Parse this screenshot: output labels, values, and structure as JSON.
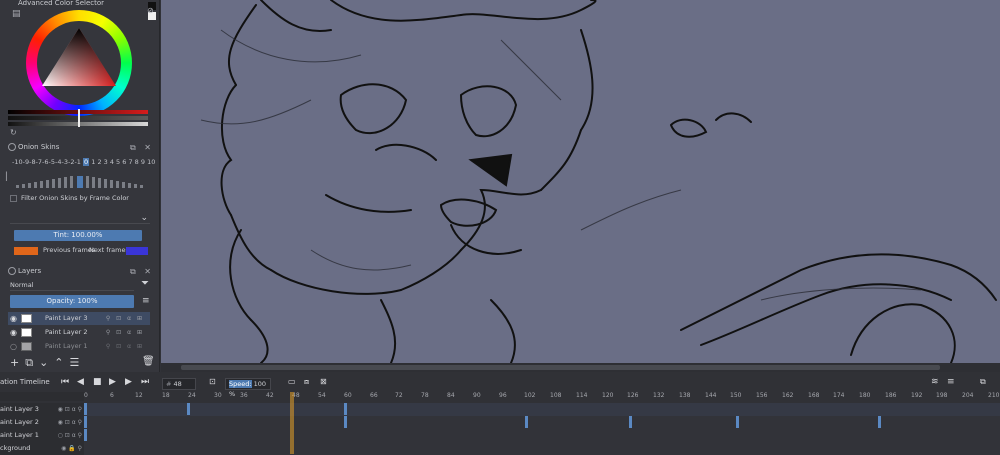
{
  "color_selector": {
    "title": "Advanced Color Selector"
  },
  "onion_skins": {
    "title": "Onion Skins",
    "frame_numbers": "-10-9-8-7-6-5-4-3-2-1",
    "current": "0",
    "frame_numbers_after": "1 2 3 4 5 6 7 8 9 10",
    "filter_label": "Filter Onion Skins by Frame Color",
    "tint": "Tint: 100.00%",
    "previous_label": "Previous frames",
    "next_label": "Next frames",
    "previous_color": "#e0661a",
    "next_color": "#3a35d8"
  },
  "layers": {
    "title": "Layers",
    "blend_mode": "Normal",
    "opacity": "Opacity:  100%",
    "items": [
      {
        "name": "Paint Layer 3"
      },
      {
        "name": "Paint Layer 2"
      },
      {
        "name": "Paint Layer 1"
      }
    ]
  },
  "timeline": {
    "title": "ation Timeline",
    "frame": "48",
    "speed_label": "Speed:",
    "speed": "100 %",
    "ruler": [
      "0",
      "6",
      "12",
      "18",
      "24",
      "30",
      "36",
      "42",
      "48",
      "54",
      "60",
      "66",
      "72",
      "78",
      "84",
      "90",
      "96",
      "102",
      "108",
      "114",
      "120",
      "126",
      "132",
      "138",
      "144",
      "150",
      "156",
      "162",
      "168",
      "174",
      "180",
      "186",
      "192",
      "198",
      "204",
      "210"
    ],
    "rows": [
      {
        "name": "aint Layer 3"
      },
      {
        "name": "aint Layer 2"
      },
      {
        "name": "aint Layer 1"
      },
      {
        "name": "ckground"
      }
    ]
  }
}
